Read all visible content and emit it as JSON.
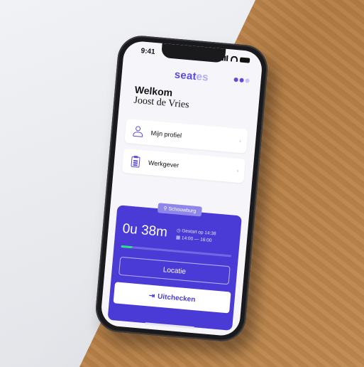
{
  "status_bar": {
    "time": "9:41"
  },
  "app": {
    "logo_main": "seat",
    "logo_faint": "es"
  },
  "welcome": {
    "title": "Welkom",
    "user_name": "Joost de Vries"
  },
  "menu": [
    {
      "label": "Mijn profiel",
      "icon": "person-icon"
    },
    {
      "label": "Werkgever",
      "icon": "clipboard-icon"
    }
  ],
  "session": {
    "location_badge": "Schouwburg",
    "elapsed": "0u 38m",
    "started": "Gestart op 14:38",
    "slot": "14:00 — 16:00",
    "progress_fraction": 0.1,
    "location_button": "Locatie",
    "checkout_button": "Uitchecken"
  },
  "colors": {
    "accent": "#4b3bd6",
    "progress": "#2fe08a",
    "background": "#f6f5f9"
  }
}
